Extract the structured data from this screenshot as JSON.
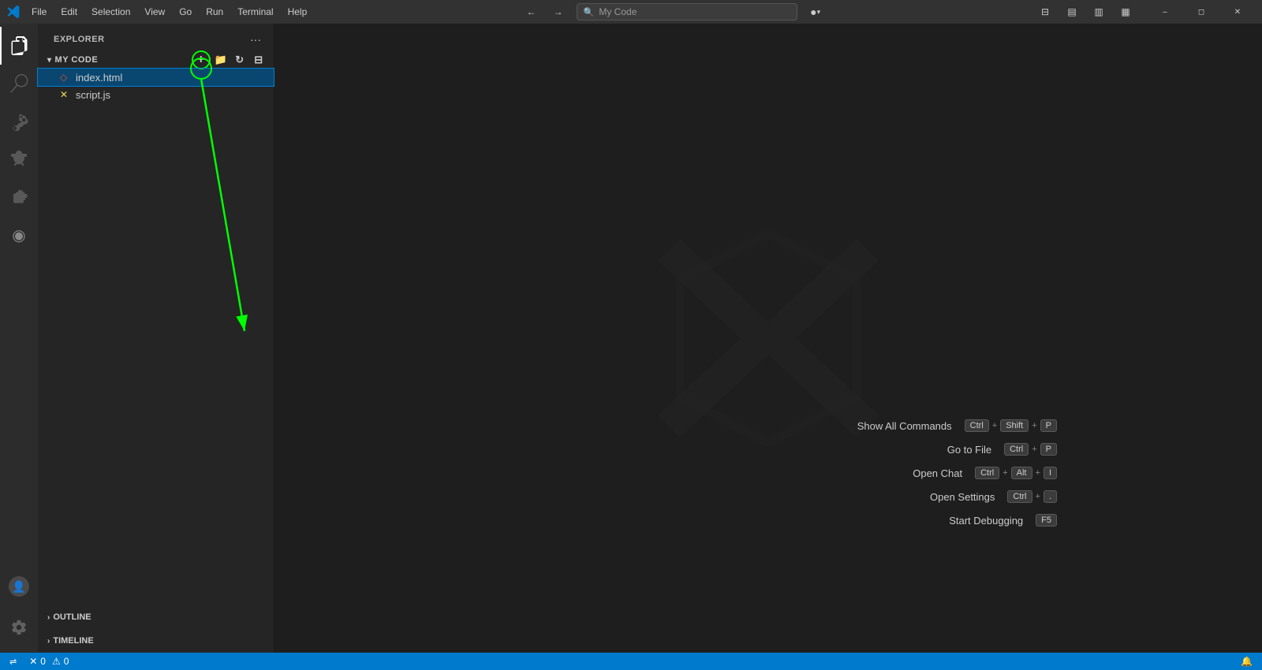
{
  "titlebar": {
    "app_name": "My Code",
    "menu": [
      "File",
      "Edit",
      "Selection",
      "View",
      "Go",
      "Run",
      "Terminal",
      "Help"
    ],
    "search_placeholder": "My Code",
    "win_buttons": [
      "minimize",
      "maximize",
      "restore",
      "close"
    ]
  },
  "activity_bar": {
    "icons": [
      {
        "name": "explorer-icon",
        "symbol": "⎘",
        "active": true
      },
      {
        "name": "search-icon",
        "symbol": "🔍"
      },
      {
        "name": "source-control-icon",
        "symbol": "⑂"
      },
      {
        "name": "run-debug-icon",
        "symbol": "▷"
      },
      {
        "name": "extensions-icon",
        "symbol": "⊞"
      },
      {
        "name": "copilot-icon",
        "symbol": "●"
      }
    ]
  },
  "sidebar": {
    "title": "EXPLORER",
    "more_button": "...",
    "folder": {
      "name": "MY CODE",
      "expanded": true
    },
    "files": [
      {
        "name": "index.html",
        "icon": "html",
        "selected": true
      },
      {
        "name": "script.js",
        "icon": "js",
        "selected": false
      }
    ],
    "toolbar": {
      "new_file": "New File",
      "new_folder": "New Folder",
      "refresh": "Refresh",
      "collapse": "Collapse"
    },
    "outline": "OUTLINE",
    "timeline": "TIMELINE"
  },
  "welcome": {
    "shortcuts": [
      {
        "label": "Show All Commands",
        "keys": [
          "Ctrl",
          "+",
          "Shift",
          "+",
          "P"
        ]
      },
      {
        "label": "Go to File",
        "keys": [
          "Ctrl",
          "+",
          "P"
        ]
      },
      {
        "label": "Open Chat",
        "keys": [
          "Ctrl",
          "+",
          "Alt",
          "+",
          "I"
        ]
      },
      {
        "label": "Open Settings",
        "keys": [
          "Ctrl",
          "+",
          "."
        ]
      },
      {
        "label": "Start Debugging",
        "keys": [
          "F5"
        ]
      }
    ]
  },
  "status_bar": {
    "errors": "0",
    "warnings": "0",
    "remote": "",
    "notifications": ""
  },
  "colors": {
    "accent_green": "#00ff00",
    "selection_blue": "#094771",
    "status_blue": "#007acc"
  }
}
